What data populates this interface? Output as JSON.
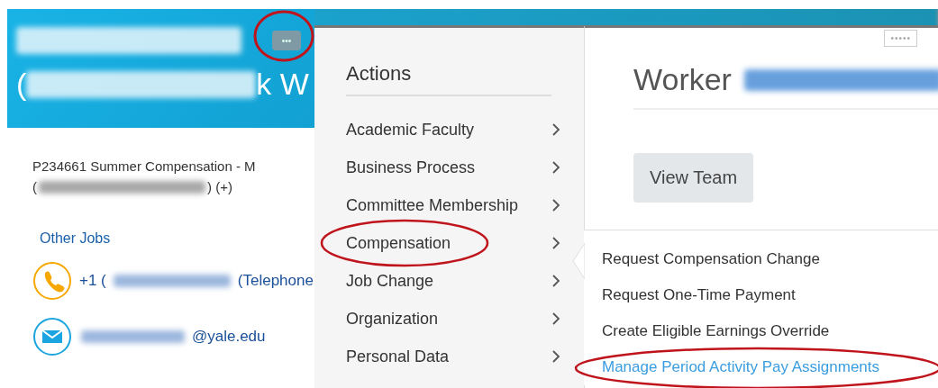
{
  "profile": {
    "more_button": "•••",
    "name_line2_start": "(",
    "name_line2_end": "k W",
    "job_line1": "P234661 Summer Compensation - M",
    "job_line2_start": "(",
    "job_line2_end": ") (+)",
    "other_jobs": "Other Jobs",
    "phone_start": "+1 (",
    "phone_end": "(Telephone",
    "email_end": "@yale.edu"
  },
  "actions": {
    "title": "Actions",
    "items": [
      {
        "label": "Academic Faculty"
      },
      {
        "label": "Business Process"
      },
      {
        "label": "Committee Membership"
      },
      {
        "label": "Compensation"
      },
      {
        "label": "Job Change"
      },
      {
        "label": "Organization"
      },
      {
        "label": "Personal Data"
      }
    ]
  },
  "worker": {
    "more": "•••••",
    "title": "Worker",
    "view_team": "View Team"
  },
  "submenu": [
    {
      "label": "Request Compensation Change",
      "selected": false
    },
    {
      "label": "Request One-Time Payment",
      "selected": false
    },
    {
      "label": "Create Eligible Earnings Override",
      "selected": false
    },
    {
      "label": "Manage Period Activity Pay Assignments",
      "selected": true
    }
  ]
}
